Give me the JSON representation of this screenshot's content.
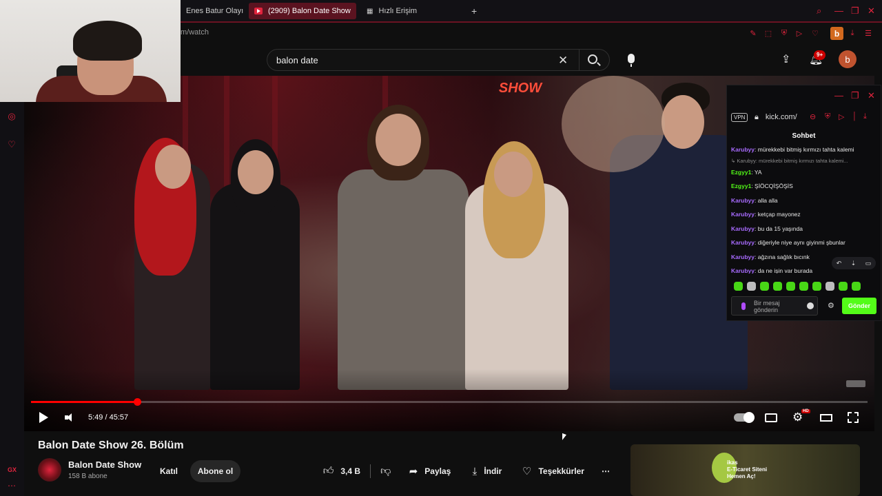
{
  "browser": {
    "tabs": [
      {
        "label": "Enes Batur Olayı -",
        "active": false
      },
      {
        "label": "(2909) Balon Date Show",
        "active": true
      },
      {
        "label": "Hızlı Erişim",
        "active": false
      }
    ],
    "new_tab_label": "+",
    "url": "m/watch",
    "profile_letter": "b",
    "accent_color": "#e0243d"
  },
  "youtube": {
    "search": {
      "query": "balon date"
    },
    "notifications_badge": "9+",
    "avatar_letter": "b"
  },
  "player": {
    "time_display": "5:49 / 45:57",
    "progress_fraction": 0.1266,
    "quality_badge": "HD",
    "scene_sign": "SHOW"
  },
  "video": {
    "title": "Balon Date Show 26. Bölüm",
    "channel_name": "Balon Date Show",
    "subscribers": "158 B abone",
    "join_label": "Katıl",
    "subscribe_label": "Abone ol",
    "likes": "3,4 B",
    "share_label": "Paylaş",
    "download_label": "İndir",
    "thanks_label": "Teşekkürler"
  },
  "kick": {
    "url": "kick.com/",
    "vpn_label": "VPN",
    "header": "Sohbet",
    "messages": [
      {
        "user": "Karubyy",
        "text": "mürekkebi bitmiş kırmızı tahta kalemi",
        "color": "#a86bff"
      },
      {
        "reply": true,
        "text": "↳ Karubyy: mürekkebi bitmiş kırmızı tahta kalemi..."
      },
      {
        "user": "Ezgyy1",
        "text": "YA",
        "color": "#53fc18"
      },
      {
        "user": "Ezgyy1",
        "text": "ŞİÖCQİŞÖŞİS",
        "color": "#53fc18"
      },
      {
        "user": "Karubyy",
        "text": "alla alla",
        "color": "#a86bff"
      },
      {
        "user": "Karubyy",
        "text": "ketçap mayonez",
        "color": "#a86bff"
      },
      {
        "user": "Karubyy",
        "text": "bu da 15 yaşında",
        "color": "#a86bff"
      },
      {
        "user": "Karubyy",
        "text": "diğeriyle niye aynı giyinmi şbunlar",
        "color": "#a86bff"
      },
      {
        "user": "Karubyy",
        "text": "ağzına sağlık bıcınk",
        "color": "#a86bff"
      },
      {
        "user": "Karubyy",
        "text": "da ne işin var burada",
        "color": "#a86bff"
      }
    ],
    "input_placeholder": "Bir mesaj gönderin",
    "send_label": "Gönder"
  },
  "ad": {
    "text_line1": "E-Ticaret Siteni",
    "text_line2": "Hemen Aç!",
    "brand": "ikas"
  },
  "sidebar": {
    "gx_label": "GX",
    "more_label": "⋯"
  }
}
